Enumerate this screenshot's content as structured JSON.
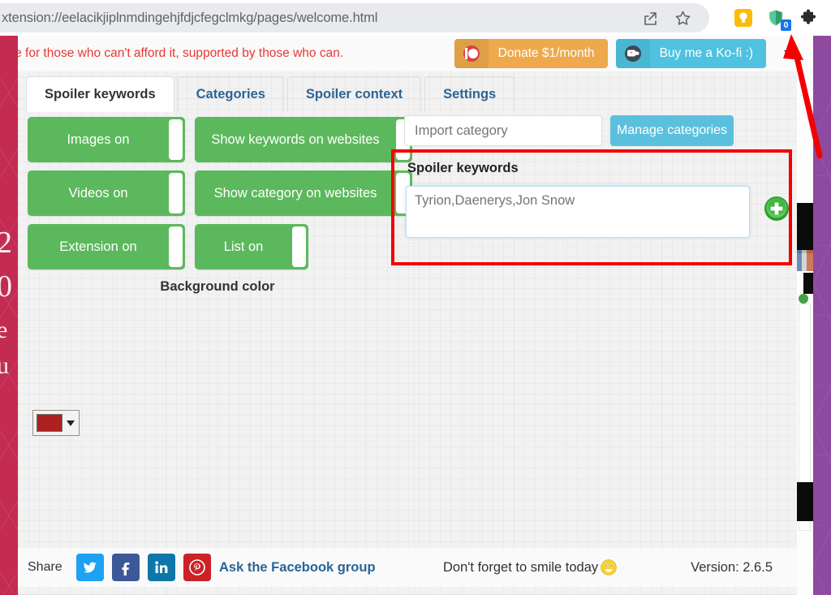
{
  "browser": {
    "url": "xtension://eelacikjiplnmdingehjfdjcfegclmkg/pages/welcome.html",
    "share_icon": "share-icon",
    "bookmark_icon": "star-icon",
    "bulb_icon": "lightbulb-icon",
    "shield_icon": "shield-extension-icon",
    "shield_badge": "0",
    "puzzle_icon": "extensions-puzzle-icon"
  },
  "banner": {
    "message": "free for those who can't afford it, supported by those who can.",
    "donate_label": "Donate $1/month",
    "donate_icon": "patreon-icon",
    "kofi_label": "Buy me a Ko-fi :)",
    "kofi_icon": "kofi-cup-icon",
    "overflow_label": "»",
    "donate_color": "#eda94c",
    "kofi_color": "#4ec2e0",
    "text_color": "#e53935"
  },
  "tabs": [
    {
      "label": "Spoiler keywords",
      "active": true
    },
    {
      "label": "Categories",
      "active": false
    },
    {
      "label": "Spoiler context",
      "active": false
    },
    {
      "label": "Settings",
      "active": false
    }
  ],
  "toggles": {
    "column_left": [
      {
        "label": "Images on",
        "state": "on"
      },
      {
        "label": "Videos on",
        "state": "on"
      },
      {
        "label": "Extension on",
        "state": "on"
      }
    ],
    "column_right": [
      {
        "label": "Show keywords on websites",
        "state": "on"
      },
      {
        "label": "Show category on websites",
        "state": "on"
      },
      {
        "label": "List on",
        "state": "on"
      }
    ],
    "on_color": "#5cb85c"
  },
  "background_color_section": {
    "label": "Background color",
    "selected_color": "#ad2122",
    "caret_icon": "chevron-down-icon"
  },
  "categories": {
    "import_placeholder": "Import category",
    "import_value": "",
    "manage_label": "Manage categories",
    "manage_color": "#5bc0de"
  },
  "spoiler_keywords": {
    "title": "Spoiler keywords",
    "placeholder": "Tyrion,Daenerys,Jon Snow",
    "value": "",
    "add_icon": "add-plus-icon",
    "highlight_color": "#f40000"
  },
  "footer": {
    "share_label": "Share",
    "social": [
      {
        "name": "twitter-icon",
        "glyph": "🐦",
        "color": "#1da1f2"
      },
      {
        "name": "facebook-icon",
        "glyph": "f",
        "color": "#3b5998"
      },
      {
        "name": "linkedin-icon",
        "glyph": "in",
        "color": "#0e76a8"
      },
      {
        "name": "pinterest-icon",
        "glyph": "P",
        "color": "#cc2127"
      }
    ],
    "facebook_group_label": "Ask the Facebook group",
    "smile_message": "Don't forget to smile today",
    "smile_icon": "smiley-face-icon",
    "version": "Version: 2.6.5"
  },
  "page_background": {
    "purple": "#8e4a9e",
    "crimson": "#c32b51",
    "ghost_chars": [
      "2",
      "0",
      "e",
      "u"
    ]
  },
  "annotation": {
    "arrow_color": "#f40000",
    "arrow_name": "red-pointer-arrow"
  }
}
